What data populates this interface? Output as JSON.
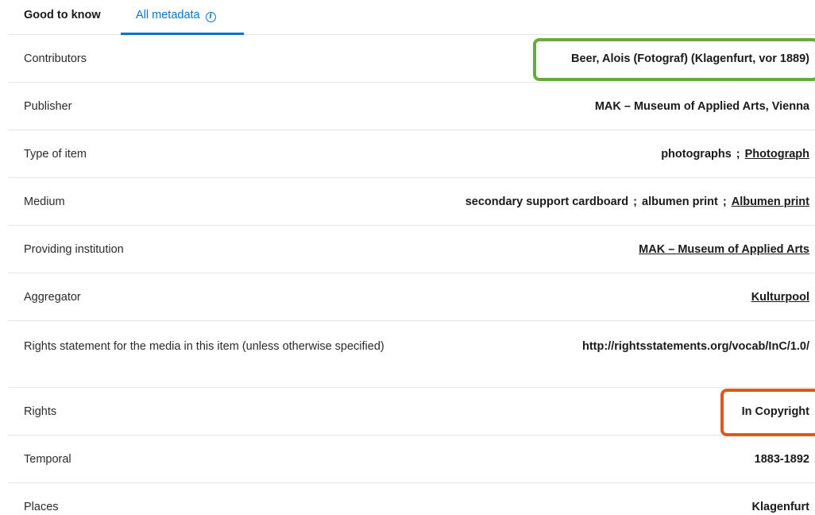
{
  "tabs": {
    "good_to_know": "Good to know",
    "all_metadata": "All metadata",
    "info_glyph": "i"
  },
  "rows": [
    {
      "label": "Contributors",
      "value": "Beer, Alois (Fotograf) (Klagenfurt, vor 1889)"
    },
    {
      "label": "Publisher",
      "value": "MAK – Museum of Applied Arts, Vienna"
    },
    {
      "label": "Type of item",
      "value_plain": "photographs",
      "value_link": "Photograph"
    },
    {
      "label": "Medium",
      "value_plain_1": "secondary support cardboard",
      "value_plain_2": "albumen print",
      "value_link": "Albumen print"
    },
    {
      "label": "Providing institution",
      "value_link": "MAK – Museum of Applied Arts"
    },
    {
      "label": "Aggregator",
      "value_link": "Kulturpool"
    },
    {
      "label": "Rights statement for the media in this item (unless otherwise specified)",
      "value": "http://rightsstatements.org/vocab/InC/1.0/"
    },
    {
      "label": "Rights",
      "value": "In Copyright"
    },
    {
      "label": "Temporal",
      "value": "1883-1892"
    },
    {
      "label": "Places",
      "value": "Klagenfurt"
    }
  ],
  "separator": ";",
  "highlight_colors": {
    "green": "#6aaa3a",
    "orange": "#e0571a"
  },
  "accent_color": "#0a72cc"
}
